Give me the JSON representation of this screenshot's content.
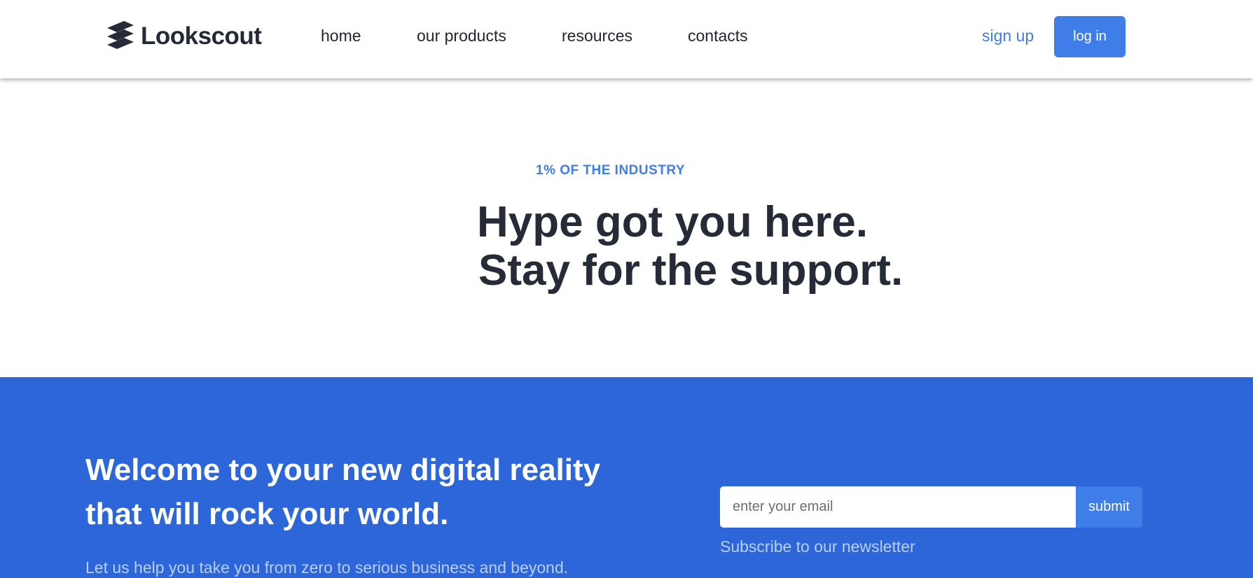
{
  "header": {
    "brand": "Lookscout",
    "logo_icon": "stacked-stripes-logo-icon",
    "nav": [
      {
        "label": "home"
      },
      {
        "label": "our products"
      },
      {
        "label": "resources"
      },
      {
        "label": "contacts"
      }
    ],
    "signup_label": "sign up",
    "login_label": "log in"
  },
  "hero": {
    "eyebrow": "1% OF THE INDUSTRY",
    "headline_line1": "Hype got you here.",
    "headline_line2": "Stay for the support."
  },
  "cta": {
    "heading_line1": "Welcome to your new digital reality",
    "heading_line2": "that will rock your world.",
    "subtext": "Let us help you take you from zero to serious business and beyond.",
    "email_placeholder": "enter your email",
    "submit_label": "submit",
    "newsletter_label": "Subscribe to our newsletter"
  },
  "colors": {
    "accent": "#3f7de8",
    "cta_background": "#2c66d9",
    "text_dark": "#262c37"
  }
}
